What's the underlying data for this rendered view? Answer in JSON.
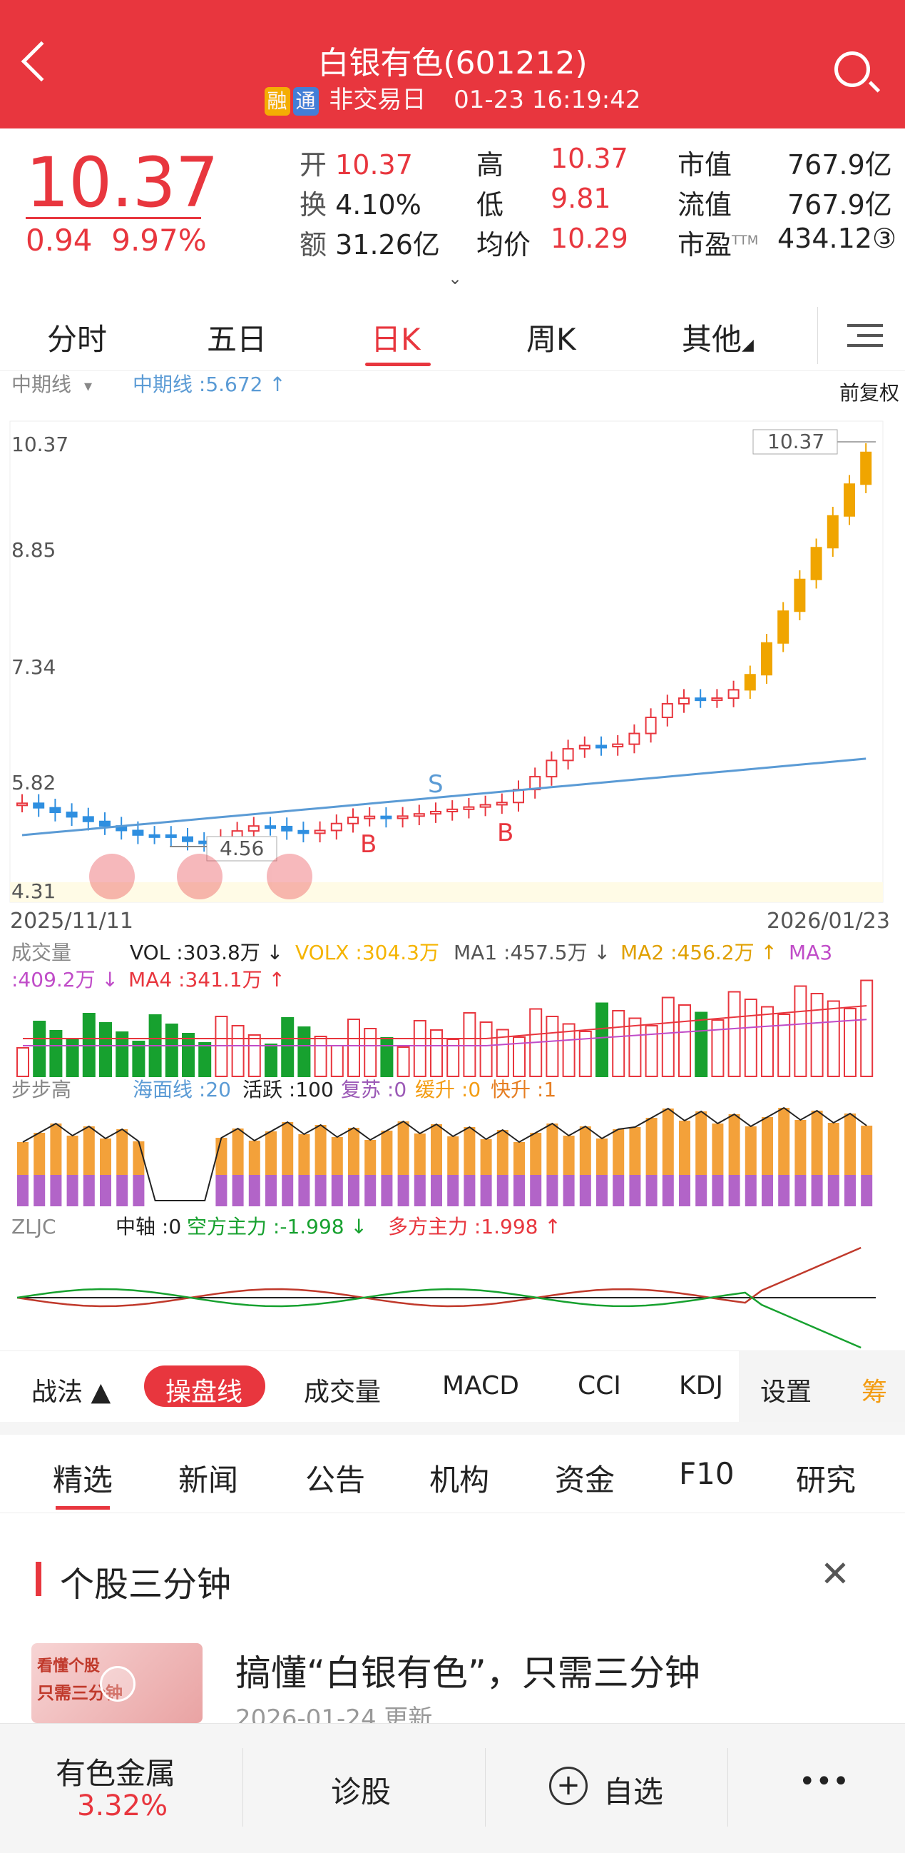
{
  "header": {
    "title": "白银有色(601212)",
    "tag_rong": "融",
    "tag_tong": "通",
    "status": "非交易日",
    "datetime": "01-23 16:19:42"
  },
  "quote": {
    "price": "10.37",
    "change": "0.94",
    "change_pct": "9.97%",
    "open_label": "开",
    "open": "10.37",
    "high_label": "高",
    "high": "10.37",
    "mktcap_label": "市值",
    "mktcap": "767.9亿",
    "turnover_label": "换",
    "turnover": "4.10%",
    "low_label": "低",
    "low": "9.81",
    "float_label": "流值",
    "float_cap": "767.9亿",
    "amount_label": "额",
    "amount": "31.26亿",
    "avg_label": "均价",
    "avg": "10.29",
    "pe_label": "市盈",
    "pe_sup": "TTM",
    "pe": "434.12③"
  },
  "tabs": [
    "分时",
    "五日",
    "日K",
    "周K",
    "其他"
  ],
  "chart": {
    "indicator_name": "中期线",
    "indicator_value": "中期线 :5.672 ↑",
    "adjust": "前复权",
    "y_ticks": [
      "10.37",
      "8.85",
      "7.34",
      "5.82",
      "4.31"
    ],
    "price_label_top": "10.37",
    "low_label": "4.56",
    "signal_s": "S",
    "signal_b": "B",
    "date_start": "2025/11/11",
    "date_end": "2026/01/23",
    "vol_name": "成交量",
    "vol_line1_vol": "VOL :303.8万 ↓",
    "vol_line1_volx": "VOLX :304.3万",
    "vol_line1_ma1": "MA1 :457.5万 ↓",
    "vol_line1_ma2": "MA2 :456.2万 ↑",
    "vol_line1_ma3": "MA3",
    "vol_line2_ma3": ":409.2万 ↓",
    "vol_line2_ma4": "MA4 :341.1万 ↑",
    "bbg_name": "步步高",
    "bbg_hmx": "海面线 :20",
    "bbg_hy": "活跃 :100",
    "bbg_fs": "复苏 :0",
    "bbg_hs": "缓升 :0",
    "bbg_ks": "快升 :1",
    "zljc_name": "ZLJC",
    "zljc_axis": "中轴 :0",
    "zljc_short": "空方主力 :-1.998 ↓",
    "zljc_long": "多方主力 :1.998 ↑"
  },
  "indicator_bar": [
    "战法 ▲",
    "操盘线",
    "成交量",
    "MACD",
    "CCI",
    "KDJ",
    "设置",
    "筹"
  ],
  "news_tabs": [
    "精选",
    "新闻",
    "公告",
    "机构",
    "资金",
    "F10",
    "研究"
  ],
  "card": {
    "section_title": "个股三分钟",
    "headline": "搞懂“白银有色”，只需三分钟",
    "updated": "2026-01-24 更新",
    "thumb_text1": "看懂个股",
    "thumb_text2": "只需三分钟"
  },
  "bottom": {
    "sector": "有色金属",
    "sector_pct": "3.32%",
    "diagnose": "诊股",
    "watch": "自选",
    "more": "•••"
  },
  "colors": {
    "red": "#e8363e",
    "green": "#17a12f",
    "ma_blue": "#5b9bd5",
    "orange": "#f39c12"
  }
}
